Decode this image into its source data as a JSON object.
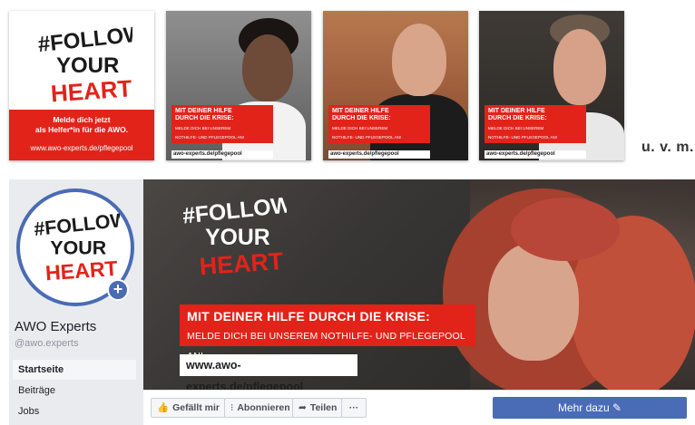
{
  "logo": {
    "line1": "#FOLLOW",
    "line2": "YOUR",
    "line3": "HEART"
  },
  "logo_tile": {
    "text_line1": "Melde dich jetzt",
    "text_line2": "als Helfer*in für die AWO.",
    "url": "www.awo-experts.de/pflegepool"
  },
  "photo_tiles": [
    {
      "headline_1": "MIT DEINER HILFE",
      "headline_2": "DURCH DIE KRISE:",
      "sub_1": "MELDE DICH BEI UNSEREM",
      "sub_2": "NOTHILFE- UND PFLEGEPOOL AN!",
      "url": "awo-experts.de/pflegepool"
    },
    {
      "headline_1": "MIT DEINER HILFE",
      "headline_2": "DURCH DIE KRISE:",
      "sub_1": "MELDE DICH BEI UNSEREM",
      "sub_2": "NOTHILFE- UND PFLEGEPOOL AN!",
      "url": "awo-experts.de/pflegepool"
    },
    {
      "headline_1": "MIT DEINER HILFE",
      "headline_2": "DURCH DIE KRISE:",
      "sub_1": "MELDE DICH BEI UNSEREM",
      "sub_2": "NOTHILFE- UND PFLEGEPOOL AN!",
      "url": "awo-experts.de/pflegepool"
    }
  ],
  "more_label": "u. v. m.",
  "fb_page": {
    "name": "AWO Experts",
    "handle": "@awo.experts",
    "nav": [
      "Startseite",
      "Beiträge",
      "Jobs"
    ],
    "cover": {
      "headline": "MIT DEINER HILFE DURCH DIE KRISE:",
      "subline": "MELDE DICH BEI UNSEREM NOTHILFE- UND PFLEGEPOOL AN!",
      "url": "www.awo-experts.de/pflegepool"
    },
    "actions": {
      "like": "Gefällt mir",
      "subscribe": "Abonnieren",
      "share": "Teilen",
      "more": "···",
      "cta": "Mehr dazu"
    },
    "icons": {
      "like": "thumbs-up-icon",
      "subscribe": "rss-icon",
      "share": "share-arrow-icon",
      "cta": "pencil-icon",
      "plus": "plus-icon"
    }
  },
  "colors": {
    "brand_red": "#e2231a",
    "fb_blue": "#4a6bb5",
    "fb_bg": "#e9ebee"
  }
}
